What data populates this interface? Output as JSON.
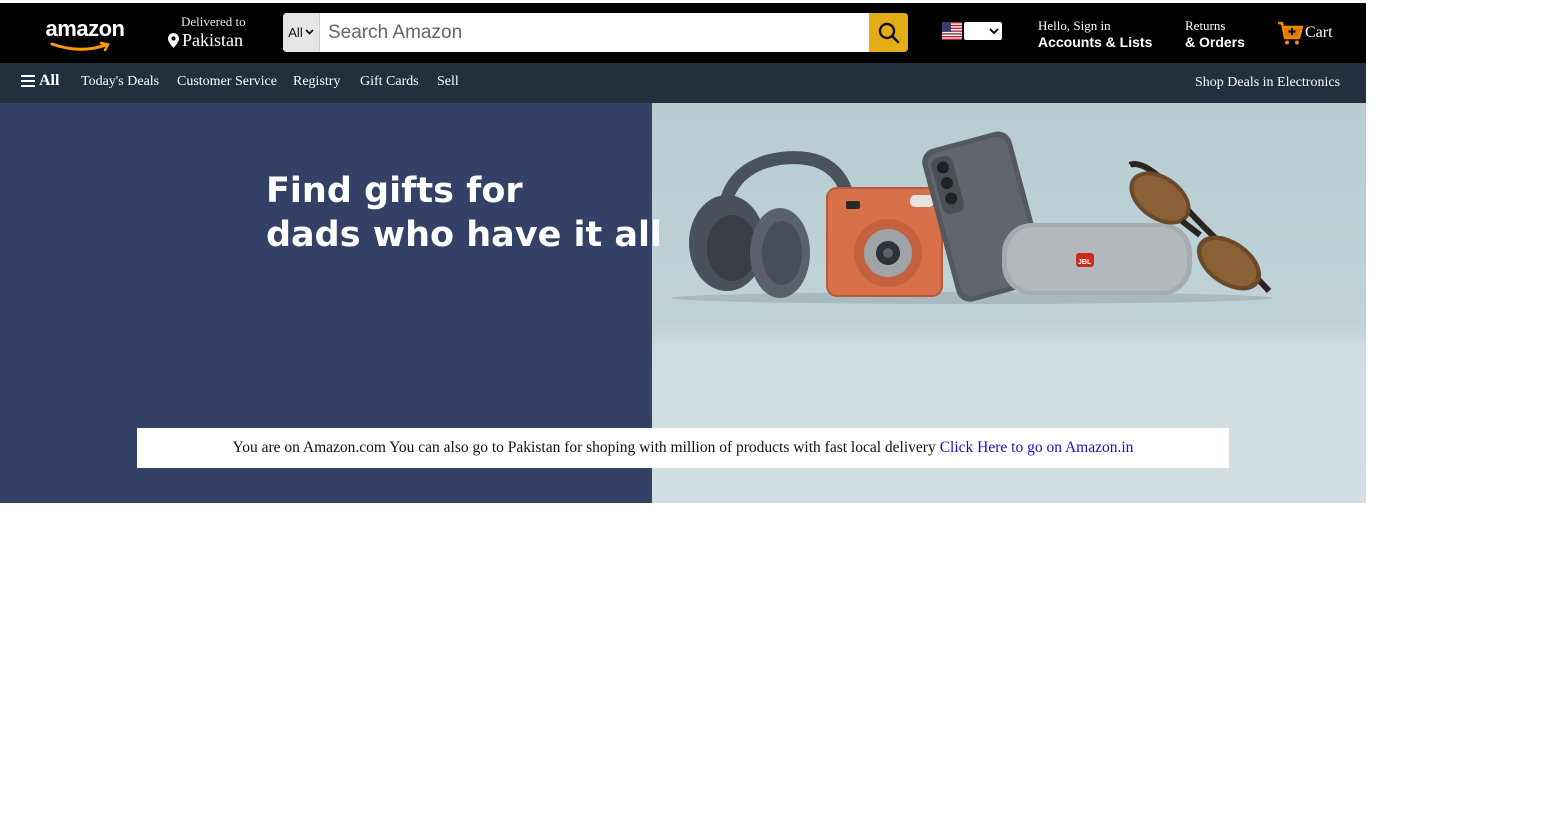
{
  "header": {
    "logo_text": "amazon",
    "deliver_small": "Delivered to",
    "deliver_location": "Pakistan",
    "search_category": "All",
    "search_placeholder": "Search Amazon",
    "account_small": "Hello, Sign in",
    "account_bold": "Accounts & Lists",
    "returns_small": "Returns",
    "returns_bold": "& Orders",
    "cart_label": "Cart"
  },
  "subnav": {
    "all_label": "All",
    "items": [
      "Today's Deals",
      "Customer Service",
      "Registry",
      "Gift Cards",
      "Sell"
    ],
    "right_link": "Shop Deals in Electronics"
  },
  "hero": {
    "title_line1": "Find gifts for",
    "title_line2": "dads who have it all",
    "product_brand": "JBL"
  },
  "notice": {
    "text": "You are on Amazon.com You can also go to Pakistan for shoping with million of products with fast local delivery",
    "link_text": "Click Here to go on Amazon.in"
  },
  "colors": {
    "topnav": "#000000",
    "subnav": "#232f3e",
    "search_button": "#e3ad15",
    "hero_left": "#334166",
    "hero_right": "#bfd3d7",
    "link": "#1a0dcc",
    "cart_accent": "#f08804"
  },
  "icons": [
    "amazon-smile-icon",
    "location-pin-icon",
    "chevron-down-icon",
    "search-icon",
    "us-flag-icon",
    "cart-icon",
    "hamburger-icon"
  ]
}
